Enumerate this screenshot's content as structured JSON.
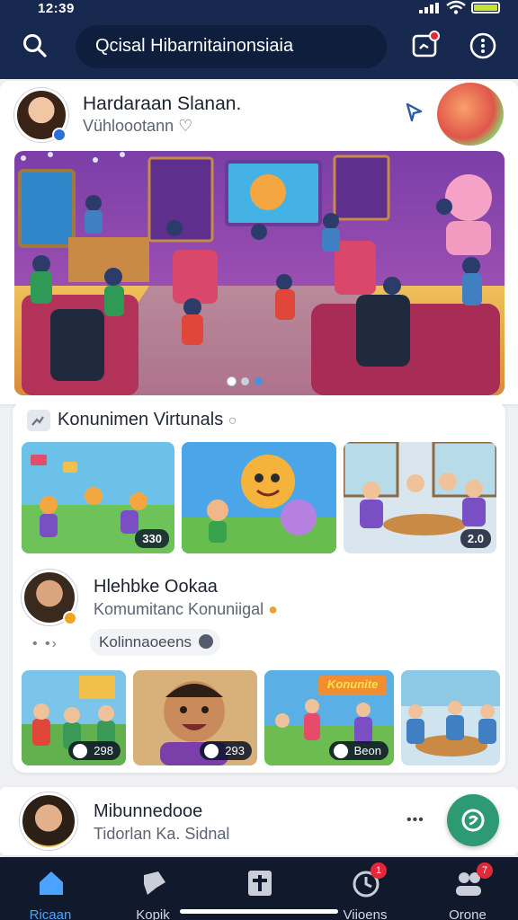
{
  "status_bar": {
    "time": "12:39"
  },
  "header": {
    "search_text": "Qcisal Hibarnitainonsiaia",
    "icons": [
      "search-icon",
      "chat-icon",
      "more-icon"
    ]
  },
  "post": {
    "author_name": "Hardaraan Slanan.",
    "author_sub": "Vühloootann",
    "image_alt": "community gathering illustration",
    "carousel_pages": 3
  },
  "section": {
    "title": "Konunimen Virtunals",
    "thumbs": [
      {
        "count": "330"
      },
      {
        "count": ""
      },
      {
        "count": "2.0"
      }
    ],
    "member": {
      "name": "Hlehbke Ookaa",
      "sub": "Komumitanc Konuniigal",
      "chip": "Kolinnaoeens"
    },
    "row2": [
      {
        "count": "298"
      },
      {
        "count": "293"
      },
      {
        "count": "Beon"
      },
      {
        "count": ""
      }
    ],
    "banner_text": "Konunite"
  },
  "profile_bar": {
    "name": "Mibunnedooe",
    "sub": "Tidorlan Ka. Sidnal"
  },
  "bottom_nav": [
    {
      "label": "Ricaan",
      "icon": "home-icon",
      "active": true
    },
    {
      "label": "Kopik",
      "icon": "tag-icon",
      "active": false
    },
    {
      "label": "",
      "icon": "book-icon",
      "active": false
    },
    {
      "label": "Viioens",
      "icon": "clock-icon",
      "active": false,
      "badge": "1"
    },
    {
      "label": "Orone",
      "icon": "people-icon",
      "active": false,
      "badge": "7"
    }
  ],
  "colors": {
    "header": "#17294f",
    "accent": "#e0474f",
    "nav_bg": "#111a2c",
    "active": "#4aa3ff",
    "fab": "#2e9a74"
  }
}
